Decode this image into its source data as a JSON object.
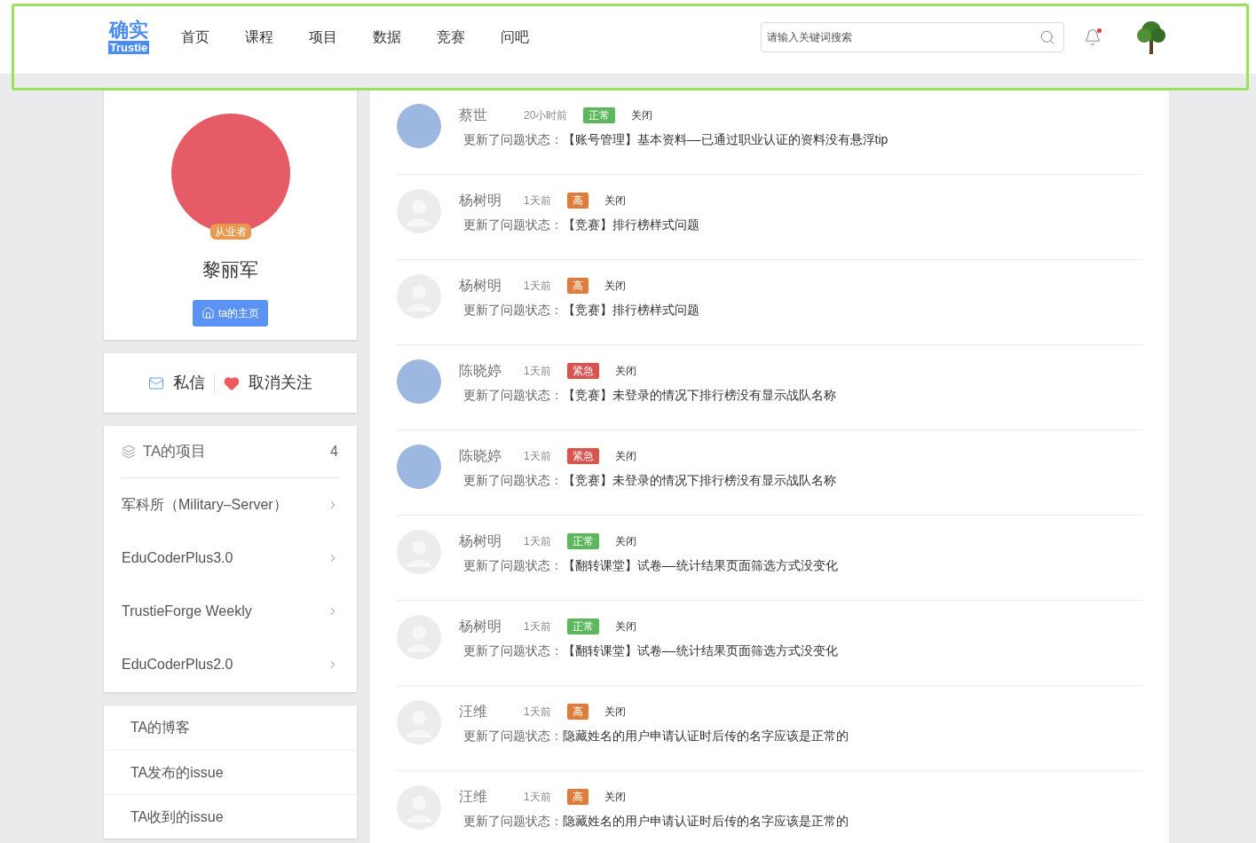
{
  "header": {
    "logo": {
      "mark": "确实",
      "word": "Trustie"
    },
    "nav": [
      {
        "label": "首页"
      },
      {
        "label": "课程"
      },
      {
        "label": "项目"
      },
      {
        "label": "数据"
      },
      {
        "label": "竞赛"
      },
      {
        "label": "问吧"
      }
    ],
    "search": {
      "placeholder": "请输入关键词搜索"
    },
    "notifications": {
      "unread": true
    }
  },
  "profile": {
    "badge": "从业者",
    "name": "黎丽军",
    "home_button": "ta的主页"
  },
  "actions": [
    {
      "kind": "message",
      "label": "私信"
    },
    {
      "kind": "unfollow",
      "label": "取消关注"
    }
  ],
  "projects": {
    "title": "TA的项目",
    "count": "4",
    "items": [
      {
        "label": "军科所（Military–Server）"
      },
      {
        "label": "EduCoderPlus3.0"
      },
      {
        "label": "TrustieForge Weekly"
      },
      {
        "label": "EduCoderPlus2.0"
      }
    ]
  },
  "links": [
    {
      "label": "TA的博客"
    },
    {
      "label": "TA发布的issue"
    },
    {
      "label": "TA收到的issue"
    }
  ],
  "feed": [
    {
      "kind": "photo",
      "user": "蔡世",
      "time": "20小时前",
      "priority": "正常",
      "color": "#5cb85c",
      "status": "关闭",
      "action": "更新了问题状态：",
      "title": "【账号管理】基本资料––已通过职业认证的资料没有悬浮tip"
    },
    {
      "kind": "default",
      "user": "杨树明",
      "time": "1天前",
      "priority": "高",
      "color": "#e07b39",
      "status": "关闭",
      "action": "更新了问题状态：",
      "title": "【竞赛】排行榜样式问题"
    },
    {
      "kind": "default",
      "user": "杨树明",
      "time": "1天前",
      "priority": "高",
      "color": "#e07b39",
      "status": "关闭",
      "action": "更新了问题状态：",
      "title": "【竞赛】排行榜样式问题"
    },
    {
      "kind": "photo",
      "user": "陈晓婷",
      "time": "1天前",
      "priority": "紧急",
      "color": "#d9534f",
      "status": "关闭",
      "action": "更新了问题状态：",
      "title": "【竞赛】未登录的情况下排行榜没有显示战队名称"
    },
    {
      "kind": "photo",
      "user": "陈晓婷",
      "time": "1天前",
      "priority": "紧急",
      "color": "#d9534f",
      "status": "关闭",
      "action": "更新了问题状态：",
      "title": "【竞赛】未登录的情况下排行榜没有显示战队名称"
    },
    {
      "kind": "default",
      "user": "杨树明",
      "time": "1天前",
      "priority": "正常",
      "color": "#5cb85c",
      "status": "关闭",
      "action": "更新了问题状态：",
      "title": "【翻转课堂】试卷––统计结果页面筛选方式没变化"
    },
    {
      "kind": "default",
      "user": "杨树明",
      "time": "1天前",
      "priority": "正常",
      "color": "#5cb85c",
      "status": "关闭",
      "action": "更新了问题状态：",
      "title": "【翻转课堂】试卷––统计结果页面筛选方式没变化"
    },
    {
      "kind": "default",
      "user": "汪维",
      "time": "1天前",
      "priority": "高",
      "color": "#e07b39",
      "status": "关闭",
      "action": "更新了问题状态：",
      "title": "隐藏姓名的用户申请认证时后传的名字应该是正常的"
    },
    {
      "kind": "default",
      "user": "汪维",
      "time": "1天前",
      "priority": "高",
      "color": "#e07b39",
      "status": "关闭",
      "action": "更新了问题状态：",
      "title": "隐藏姓名的用户申请认证时后传的名字应该是正常的"
    }
  ]
}
